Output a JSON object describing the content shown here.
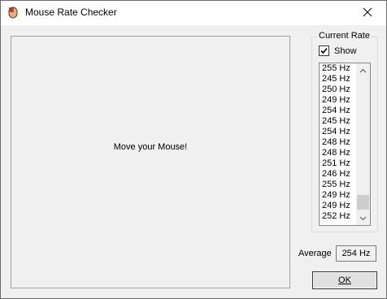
{
  "window": {
    "title": "Mouse Rate Checker",
    "icon": "mouse-app-icon"
  },
  "titlebar": {
    "close_icon": "close-icon"
  },
  "canvas": {
    "message": "Move your Mouse!"
  },
  "current_rate": {
    "legend": "Current Rate",
    "show_label": "Show",
    "show_checked": true,
    "rates": [
      "255 Hz",
      "245 Hz",
      "250 Hz",
      "249 Hz",
      "254 Hz",
      "245 Hz",
      "254 Hz",
      "248 Hz",
      "248 Hz",
      "251 Hz",
      "246 Hz",
      "255 Hz",
      "249 Hz",
      "249 Hz",
      "252 Hz"
    ]
  },
  "average": {
    "label": "Average",
    "value": "254 Hz"
  },
  "ok_button": {
    "label": "OK"
  },
  "colors": {
    "window_bg": "#f0f0f0",
    "titlebar_bg": "#ffffff",
    "list_bg": "#ffffff"
  }
}
